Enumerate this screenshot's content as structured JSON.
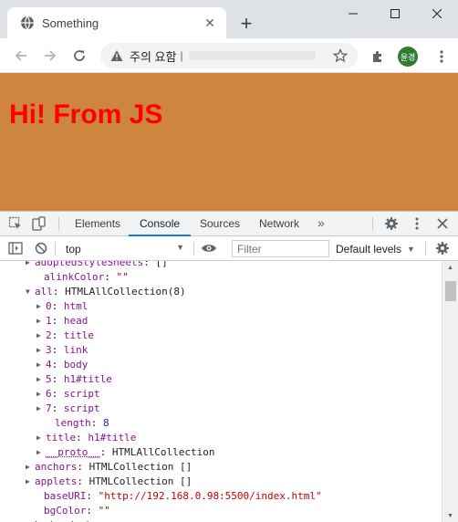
{
  "browser": {
    "tab_title": "Something",
    "tab_close": "✕",
    "new_tab": "+",
    "omnibox_warning": "주의 요함",
    "omnibox_separator": "|",
    "avatar_text": "윤경"
  },
  "page": {
    "heading": "Hi! From JS",
    "background_color": "#cd853f",
    "heading_color": "#ff0000"
  },
  "devtools": {
    "tabs": [
      "Elements",
      "Console",
      "Sources",
      "Network"
    ],
    "active_tab": "Console",
    "more_tabs": "»",
    "context": "top",
    "filter_placeholder": "Filter",
    "levels": "Default levels"
  },
  "console": {
    "lines": [
      {
        "tri": "▶",
        "key": "adoptedStyleSheets",
        "sep": ": ",
        "val": "[]",
        "kind": "p"
      },
      {
        "tri": "",
        "key": "alinkColor",
        "sep": ": ",
        "val": "\"\"",
        "kind": "s"
      },
      {
        "tri": "▼",
        "key": "all",
        "sep": ": ",
        "val": "HTMLAllCollection(8)",
        "kind": "p"
      },
      {
        "tri": "▶",
        "key": "0",
        "sep": ": ",
        "val": "html",
        "kind": "k"
      },
      {
        "tri": "▶",
        "key": "1",
        "sep": ": ",
        "val": "head",
        "kind": "k"
      },
      {
        "tri": "▶",
        "key": "2",
        "sep": ": ",
        "val": "title",
        "kind": "k"
      },
      {
        "tri": "▶",
        "key": "3",
        "sep": ": ",
        "val": "link",
        "kind": "k"
      },
      {
        "tri": "▶",
        "key": "4",
        "sep": ": ",
        "val": "body",
        "kind": "k"
      },
      {
        "tri": "▶",
        "key": "5",
        "sep": ": ",
        "val": "h1#title",
        "kind": "k"
      },
      {
        "tri": "▶",
        "key": "6",
        "sep": ": ",
        "val": "script",
        "kind": "k"
      },
      {
        "tri": "▶",
        "key": "7",
        "sep": ": ",
        "val": "script",
        "kind": "k"
      },
      {
        "tri": "",
        "key": "length",
        "sep": ": ",
        "val": "8",
        "kind": "n"
      },
      {
        "tri": "▶",
        "key": "title",
        "sep": ": ",
        "val": "h1#title",
        "kind": "k"
      },
      {
        "tri": "▶",
        "key": "__proto__",
        "sep": ": ",
        "val": "HTMLAllCollection",
        "kind": "p"
      },
      {
        "tri": "▶",
        "key": "anchors",
        "sep": ": ",
        "val": "HTMLCollection []",
        "kind": "p"
      },
      {
        "tri": "▶",
        "key": "applets",
        "sep": ": ",
        "val": "HTMLCollection []",
        "kind": "p"
      },
      {
        "tri": "",
        "key": "baseURI",
        "sep": ": ",
        "val": "\"http://192.168.0.98:5500/index.html\"",
        "kind": "s"
      },
      {
        "tri": "",
        "key": "bgColor",
        "sep": ": ",
        "val": "\"\"",
        "kind": "s"
      },
      {
        "tri": "▶",
        "key": "body",
        "sep": ": ",
        "val": "body",
        "kind": "k"
      }
    ]
  }
}
